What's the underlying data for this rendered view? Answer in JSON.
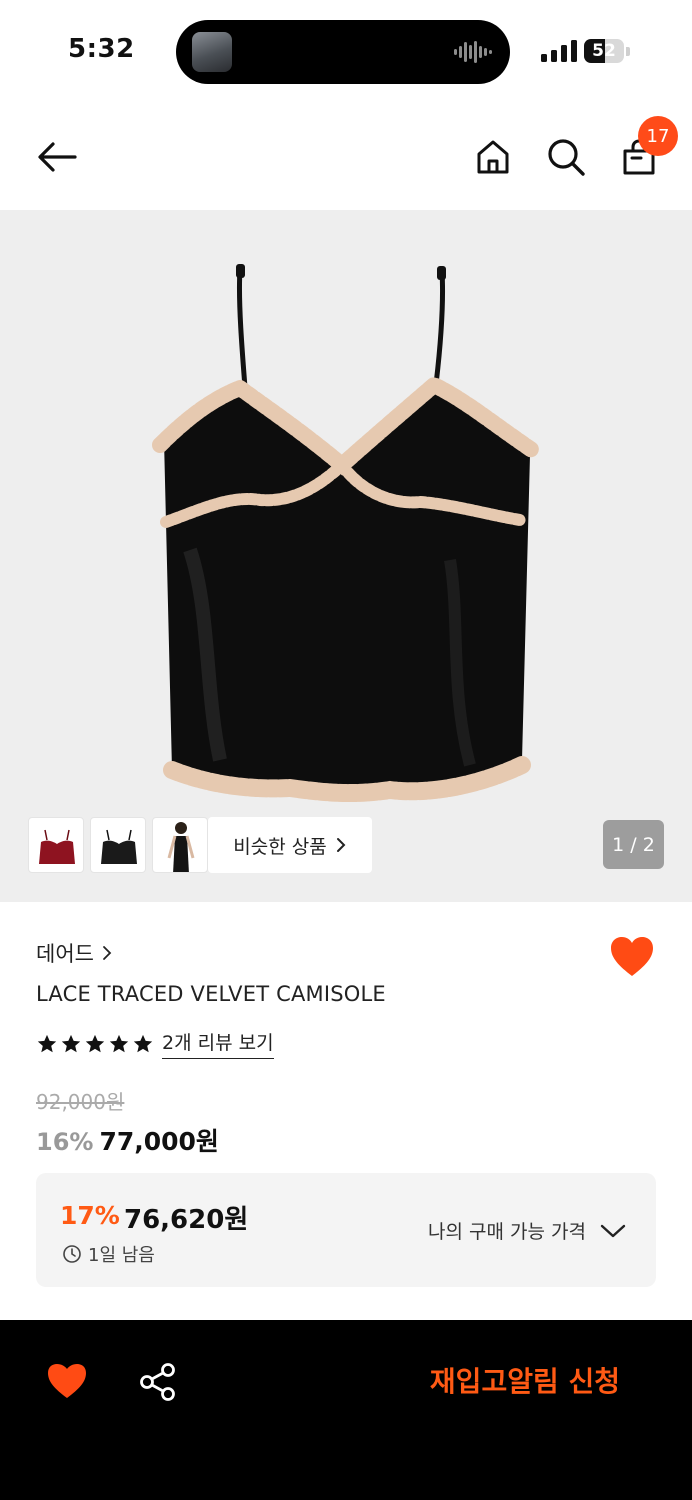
{
  "status_bar": {
    "time": "5:32",
    "battery": "52",
    "battery_level": 0.52
  },
  "header": {
    "back_icon": "arrow-left-icon",
    "home_icon": "home-icon",
    "search_icon": "search-icon",
    "cart_icon": "shopping-bag-icon",
    "cart_count": "17",
    "badge_color": "#ff4b19"
  },
  "gallery": {
    "similar_label": "비슷한 상품",
    "page_indicator": "1 / 2",
    "thumbnails": [
      "red-camisole",
      "black-camisole",
      "model-photo"
    ]
  },
  "product": {
    "brand": "데어드",
    "name": "LACE TRACED VELVET CAMISOLE",
    "rating": 5,
    "review_link": "2개 리뷰 보기",
    "original_price": "92,000원",
    "discount_rate": "16%",
    "sale_price": "77,000원",
    "wishlisted": true
  },
  "coupon": {
    "rate": "17%",
    "price": "76,620원",
    "time_left": "1일 남음",
    "my_price_label": "나의 구매 가능 가격"
  },
  "bottom_bar": {
    "restock_label": "재입고알림 신청",
    "accent_color": "#ff5a14"
  }
}
